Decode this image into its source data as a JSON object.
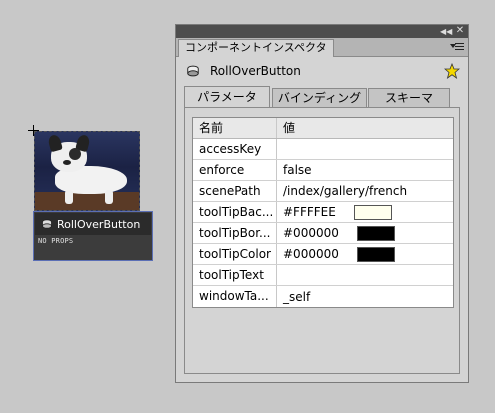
{
  "stage": {
    "component_name": "RollOverButton",
    "props_label": "NO PROPS"
  },
  "panel": {
    "tab_title": "コンポーネントインスペクタ",
    "component_title": "RollOverButton",
    "tabs": [
      {
        "label": "パラメータ",
        "active": true
      },
      {
        "label": "バインディング",
        "active": false
      },
      {
        "label": "スキーマ",
        "active": false
      }
    ],
    "grid": {
      "header_name": "名前",
      "header_value": "値",
      "rows": [
        {
          "name": "accessKey",
          "value": ""
        },
        {
          "name": "enforce",
          "value": "false"
        },
        {
          "name": "scenePath",
          "value": "/index/gallery/french"
        },
        {
          "name": "toolTipBac...",
          "value": "#FFFFEE",
          "swatch": "#FFFFEE"
        },
        {
          "name": "toolTipBor...",
          "value": "#000000",
          "swatch": "#000000"
        },
        {
          "name": "toolTipColor",
          "value": "#000000",
          "swatch": "#000000"
        },
        {
          "name": "toolTipText",
          "value": ""
        },
        {
          "name": "windowTa...",
          "value": "_self"
        }
      ]
    }
  },
  "icons": {
    "panel_collapse": "double-chevron-icon",
    "panel_close": "close-icon",
    "panel_menu": "menu-icon",
    "component": "component-icon",
    "live_preview": "star-icon"
  },
  "colors": {
    "background": "#c8c8c8",
    "panel": "#d4d4d4",
    "titlebar": "#4d4d4d",
    "selection_border": "#5b6fb5",
    "star": "#f5d800"
  }
}
